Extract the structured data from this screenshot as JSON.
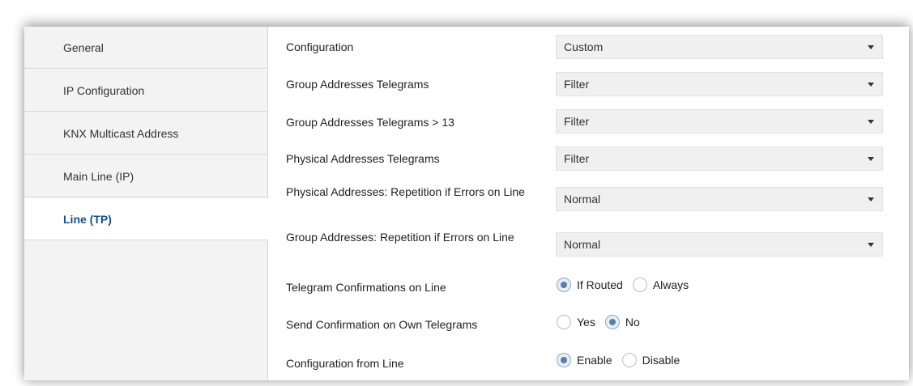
{
  "sidebar": {
    "items": [
      {
        "label": "General"
      },
      {
        "label": "IP Configuration"
      },
      {
        "label": "KNX Multicast Address"
      },
      {
        "label": "Main Line (IP)"
      },
      {
        "label": "Line (TP)",
        "active": true
      }
    ]
  },
  "settings": {
    "configuration": {
      "label": "Configuration",
      "value": "Custom"
    },
    "group_telegrams": {
      "label": "Group Addresses Telegrams",
      "value": "Filter"
    },
    "group_telegrams_13": {
      "label": "Group Addresses Telegrams > 13",
      "value": "Filter"
    },
    "physical_telegrams": {
      "label": "Physical Addresses Telegrams",
      "value": "Filter"
    },
    "physical_repetition": {
      "label": "Physical Addresses: Repetition if Errors on Line",
      "value": "Normal"
    },
    "group_repetition": {
      "label": "Group Addresses: Repetition if Errors on Line",
      "value": "Normal"
    },
    "telegram_confirmations": {
      "label": "Telegram Confirmations on Line",
      "options": [
        "If Routed",
        "Always"
      ],
      "selected": "If Routed"
    },
    "send_confirmation": {
      "label": "Send Confirmation on Own Telegrams",
      "options": [
        "Yes",
        "No"
      ],
      "selected": "No"
    },
    "config_from_line": {
      "label": "Configuration from Line",
      "options": [
        "Enable",
        "Disable"
      ],
      "selected": "Enable"
    }
  }
}
